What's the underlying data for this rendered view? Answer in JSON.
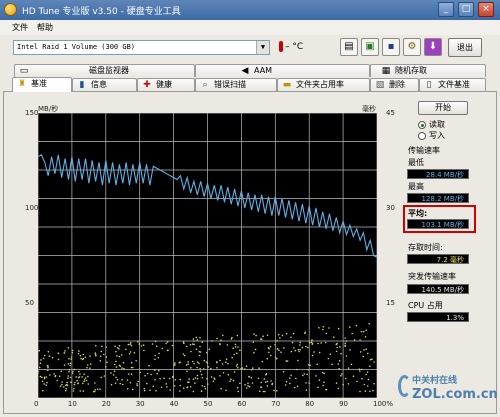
{
  "window": {
    "title": "HD Tune 专业版 v3.50 - 硬盘专业工具"
  },
  "menu": {
    "file": "文件",
    "help": "帮助"
  },
  "toolbar": {
    "drive": "Intel   Raid 1 Volume (300 GB)",
    "temperature": "– °C",
    "exit_label": "退出",
    "icons": [
      "copy-text-icon",
      "copy-screenshot-icon",
      "save-icon",
      "options-icon",
      "down-arrow-icon"
    ]
  },
  "tabs": {
    "row1": [
      {
        "label": "磁盘监视器",
        "icon": "monitor-icon"
      },
      {
        "label": "AAM",
        "icon": "speaker-icon"
      },
      {
        "label": "随机存取",
        "icon": "random-access-icon"
      }
    ],
    "row2": [
      {
        "label": "基准",
        "icon": "benchmark-icon"
      },
      {
        "label": "信息",
        "icon": "info-icon"
      },
      {
        "label": "健康",
        "icon": "health-icon"
      },
      {
        "label": "错误扫描",
        "icon": "error-scan-icon"
      },
      {
        "label": "文件夹占用率",
        "icon": "folder-usage-icon"
      },
      {
        "label": "删除",
        "icon": "erase-icon"
      },
      {
        "label": "文件基准",
        "icon": "file-benchmark-icon"
      }
    ]
  },
  "side": {
    "start_label": "开始",
    "read_label": "读取",
    "write_label": "写入",
    "transfer_rate_label": "传输速率",
    "min_label": "最低",
    "min_value": "28.4 MB/秒",
    "max_label": "最高",
    "max_value": "128.2 MB/秒",
    "avg_label": "平均:",
    "avg_value": "103.1 MB/秒",
    "access_time_label": "存取时间:",
    "access_time_value": "7.2 毫秒",
    "burst_label": "突发传输速率",
    "burst_value": "140.5 MB/秒",
    "cpu_label": "CPU 占用",
    "cpu_value": "1.3%"
  },
  "watermark": {
    "top": "中关村在线",
    "bottom": "ZOL.com.cn"
  },
  "chart_data": {
    "type": "line",
    "y_left_label": "MB/秒",
    "y_right_label": "毫秒",
    "y_left_ticks": [
      "150",
      "100",
      "50"
    ],
    "y_right_ticks": [
      "45",
      "30",
      "15"
    ],
    "x_ticks": [
      "0",
      "10",
      "20",
      "30",
      "40",
      "50",
      "60",
      "70",
      "80",
      "90",
      "100"
    ],
    "x_unit": "%",
    "ylim_left": [
      0,
      150
    ],
    "ylim_right": [
      0,
      45
    ],
    "xlim": [
      0,
      100
    ],
    "grid": true,
    "series": [
      {
        "color": "#5fb1e6",
        "x": [
          0,
          1,
          2,
          3,
          4,
          5,
          6,
          7,
          8,
          9,
          10,
          11,
          12,
          13,
          14,
          15,
          16,
          17,
          18,
          19,
          20,
          21,
          22,
          23,
          24,
          25,
          26,
          27,
          28,
          29,
          30,
          31,
          32,
          33,
          34,
          35,
          36,
          37,
          38,
          39,
          40,
          41,
          42,
          43,
          44,
          45,
          46,
          47,
          48,
          49,
          50,
          51,
          52,
          53,
          54,
          55,
          56,
          57,
          58,
          59,
          60,
          61,
          62,
          63,
          64,
          65,
          66,
          67,
          68,
          69,
          70,
          71,
          72,
          73,
          74,
          75,
          76,
          77,
          78,
          79,
          80,
          81,
          82,
          83,
          84,
          85,
          86,
          87,
          88,
          89,
          90,
          91,
          92,
          93,
          94,
          95,
          96,
          97,
          98,
          99,
          100
        ],
        "y": [
          127,
          128,
          124,
          117,
          127,
          118,
          128,
          116,
          126,
          115,
          127,
          114,
          126,
          115,
          126,
          113,
          125,
          114,
          124,
          112,
          125,
          113,
          124,
          112,
          123,
          113,
          124,
          112,
          123,
          113,
          124,
          113,
          123,
          112,
          122,
          121,
          120,
          119,
          118,
          117,
          116,
          115,
          117,
          110,
          116,
          108,
          114,
          107,
          114,
          106,
          113,
          105,
          112,
          104,
          112,
          103,
          111,
          102,
          110,
          101,
          109,
          100,
          108,
          99,
          107,
          98,
          107,
          97,
          106,
          96,
          106,
          96,
          105,
          95,
          104,
          94,
          103,
          93,
          102,
          92,
          101,
          91,
          100,
          90,
          98,
          89,
          97,
          88,
          95,
          87,
          93,
          86,
          91,
          85,
          89,
          83,
          87,
          78,
          83,
          75,
          74
        ]
      }
    ],
    "access_points_range_ms": [
      1,
      12
    ]
  }
}
